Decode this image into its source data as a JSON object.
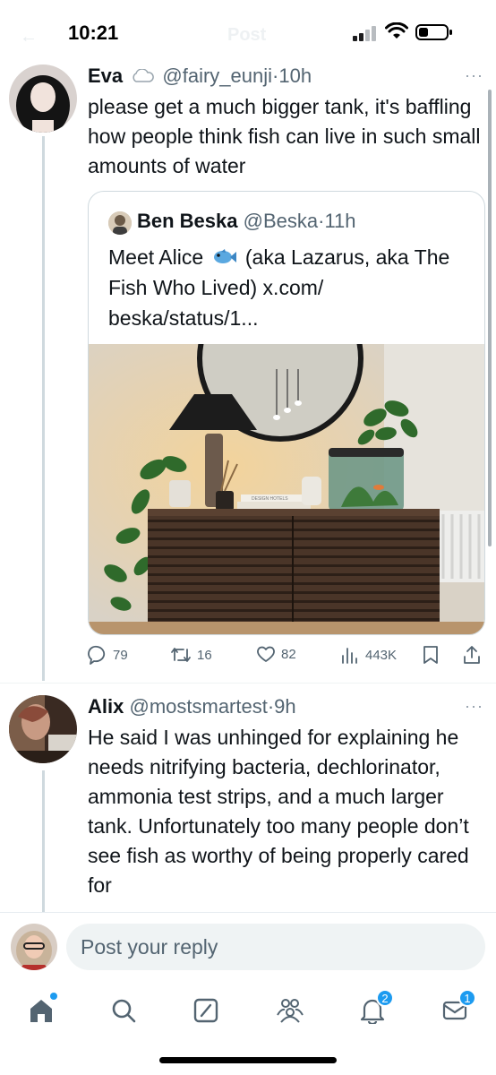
{
  "status_bar": {
    "time": "10:21",
    "ghost_back": "←",
    "ghost_title": "Post"
  },
  "tweets": [
    {
      "name": "Eva",
      "name_emoji": "☁️",
      "handle": "@fairy_eunji",
      "time": "10h",
      "more": "···",
      "text": "please get a much bigger tank, it's baffling how people think fish can live in such small amounts of water",
      "quote": {
        "name": "Ben Beska",
        "handle": "@Beska",
        "time": "11h",
        "text_before": "Meet Alice",
        "emoji": "🐟",
        "text_after": "(aka Lazarus, aka The Fish Who Lived) x.com/ beska/status/1...",
        "image_icon": "photo-fish-tank-sideboard",
        "book_label": "DESIGN HOTELS"
      },
      "actions": {
        "replies": "79",
        "reposts": "16",
        "likes": "82",
        "views": "443K"
      }
    },
    {
      "name": "Alix",
      "handle": "@mostsmartest",
      "time": "9h",
      "more": "···",
      "text": "He said I was unhinged for explaining he needs nitrifying bacteria, dechlorinator, ammonia test strips, and a much larger tank. Unfortunately too many people don’t see fish as worthy of being properly cared for"
    }
  ],
  "reply_bar": {
    "placeholder": "Post your reply"
  },
  "tab_bar": {
    "items": [
      {
        "icon": "home-icon",
        "badge": ""
      },
      {
        "icon": "search-icon",
        "badge": ""
      },
      {
        "icon": "compose-icon",
        "badge": ""
      },
      {
        "icon": "communities-icon",
        "badge": ""
      },
      {
        "icon": "notifications-icon",
        "badge": "2"
      },
      {
        "icon": "messages-icon",
        "badge": "1"
      }
    ]
  },
  "colors": {
    "accent": "#1d9bf0",
    "text": "#0f1419",
    "secondary": "#536471",
    "border": "#cfd9de"
  }
}
